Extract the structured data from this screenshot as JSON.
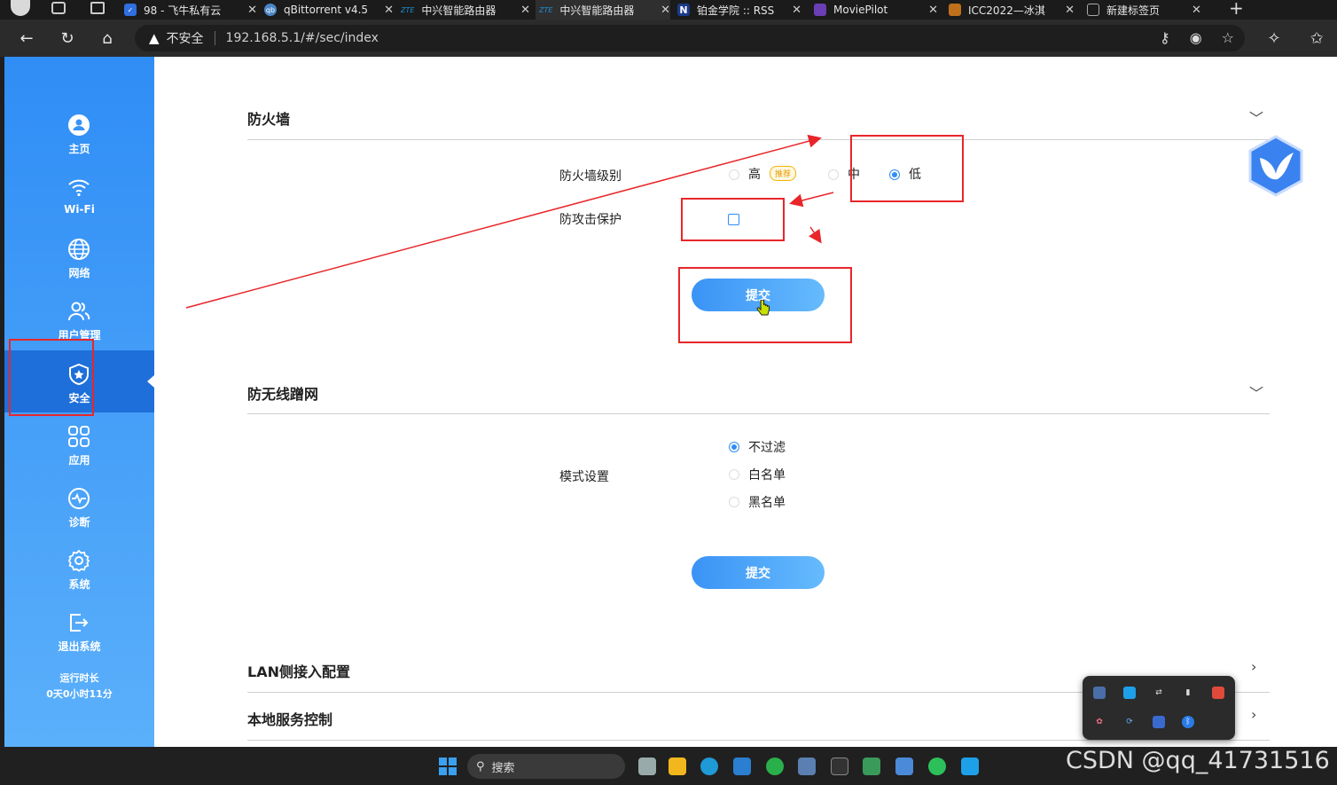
{
  "browser": {
    "tabs": [
      {
        "title": "98 - 飞牛私有云",
        "icon_color": "#2f6fe0"
      },
      {
        "title": "qBittorrent v4.5",
        "icon_color": "#4a86c8"
      },
      {
        "title": "中兴智能路由器",
        "icon_color": "#1f8fd6"
      },
      {
        "title": "中兴智能路由器",
        "icon_color": "#1f8fd6"
      },
      {
        "title": "铂金学院 :: RSS",
        "icon_color": "#1a3a8a"
      },
      {
        "title": "MoviePilot",
        "icon_color": "#6a3fb5"
      },
      {
        "title": "ICC2022—冰淇",
        "icon_color": "#c0701a"
      },
      {
        "title": "新建标签页",
        "icon_color": "#777777"
      }
    ],
    "zte_logo": "ZTE",
    "notion_logo": "N",
    "insecure_label": "不安全",
    "url": "192.168.5.1/#/sec/index"
  },
  "sidebar": {
    "items": [
      {
        "label": "主页",
        "icon": "home-user-icon"
      },
      {
        "label": "Wi-Fi",
        "icon": "wifi-icon"
      },
      {
        "label": "网络",
        "icon": "globe-icon"
      },
      {
        "label": "用户管理",
        "icon": "users-icon"
      },
      {
        "label": "安全",
        "icon": "shield-icon",
        "active": true
      },
      {
        "label": "应用",
        "icon": "apps-grid-icon"
      },
      {
        "label": "诊断",
        "icon": "pulse-icon"
      },
      {
        "label": "系统",
        "icon": "gear-icon"
      },
      {
        "label": "退出系统",
        "icon": "logout-icon"
      }
    ],
    "uptime_label": "运行时长",
    "uptime_value": "0天0小时11分"
  },
  "firewall": {
    "title": "防火墙",
    "level_label": "防火墙级别",
    "options": [
      "高",
      "中",
      "低"
    ],
    "recommended_badge": "推荐",
    "selected": "低",
    "attack_label": "防攻击保护",
    "attack_checked": false,
    "submit": "提交"
  },
  "anti_wifi": {
    "title": "防无线蹭网",
    "mode_label": "模式设置",
    "options": [
      "不过滤",
      "白名单",
      "黑名单"
    ],
    "selected": "不过滤",
    "submit": "提交"
  },
  "lan": {
    "title": "LAN侧接入配置"
  },
  "local_service": {
    "title": "本地服务控制"
  },
  "taskbar": {
    "search_placeholder": "搜索"
  },
  "watermark": "CSDN @qq_41731516",
  "colors": {
    "accent": "#2f8df5",
    "annotation": "#e8262a"
  }
}
